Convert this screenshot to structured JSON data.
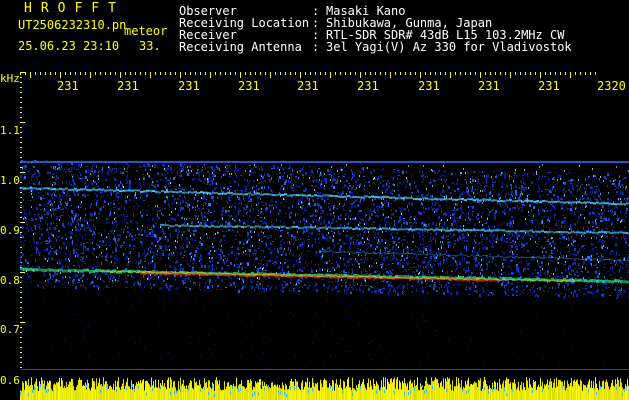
{
  "header": {
    "brand": "HROFFT",
    "filename": "UT2506232310.pn",
    "type": "meteor",
    "datetime": "25.06.23 23:10",
    "count": "33.",
    "fields": [
      {
        "label": "Observer",
        "value": "Masaki Kano"
      },
      {
        "label": "Receiving Location",
        "value": "Shibukawa, Gunma, Japan"
      },
      {
        "label": "Receiver",
        "value": "RTL-SDR SDR# 43dB L15 103.2MHz CW"
      },
      {
        "label": "Receiving Antenna",
        "value": "3el Yagi(V) Az 330 for Vladivostok"
      }
    ]
  },
  "axes": {
    "y_unit": "kHz",
    "y_ticks": [
      "1.1",
      "1.0",
      "0.9",
      "0.8",
      "0.7",
      "0.6"
    ],
    "x_ticks": [
      "231",
      "231",
      "231",
      "231",
      "231",
      "231",
      "231",
      "231",
      "231",
      "2320"
    ]
  },
  "colors": {
    "text": "#ffff00",
    "header_text": "#ffffff",
    "background": "#000000",
    "spectrum_noise": "#0a2fd0",
    "meteor_line": "#ff2a00",
    "baseline_bars": "#ffff00"
  }
}
